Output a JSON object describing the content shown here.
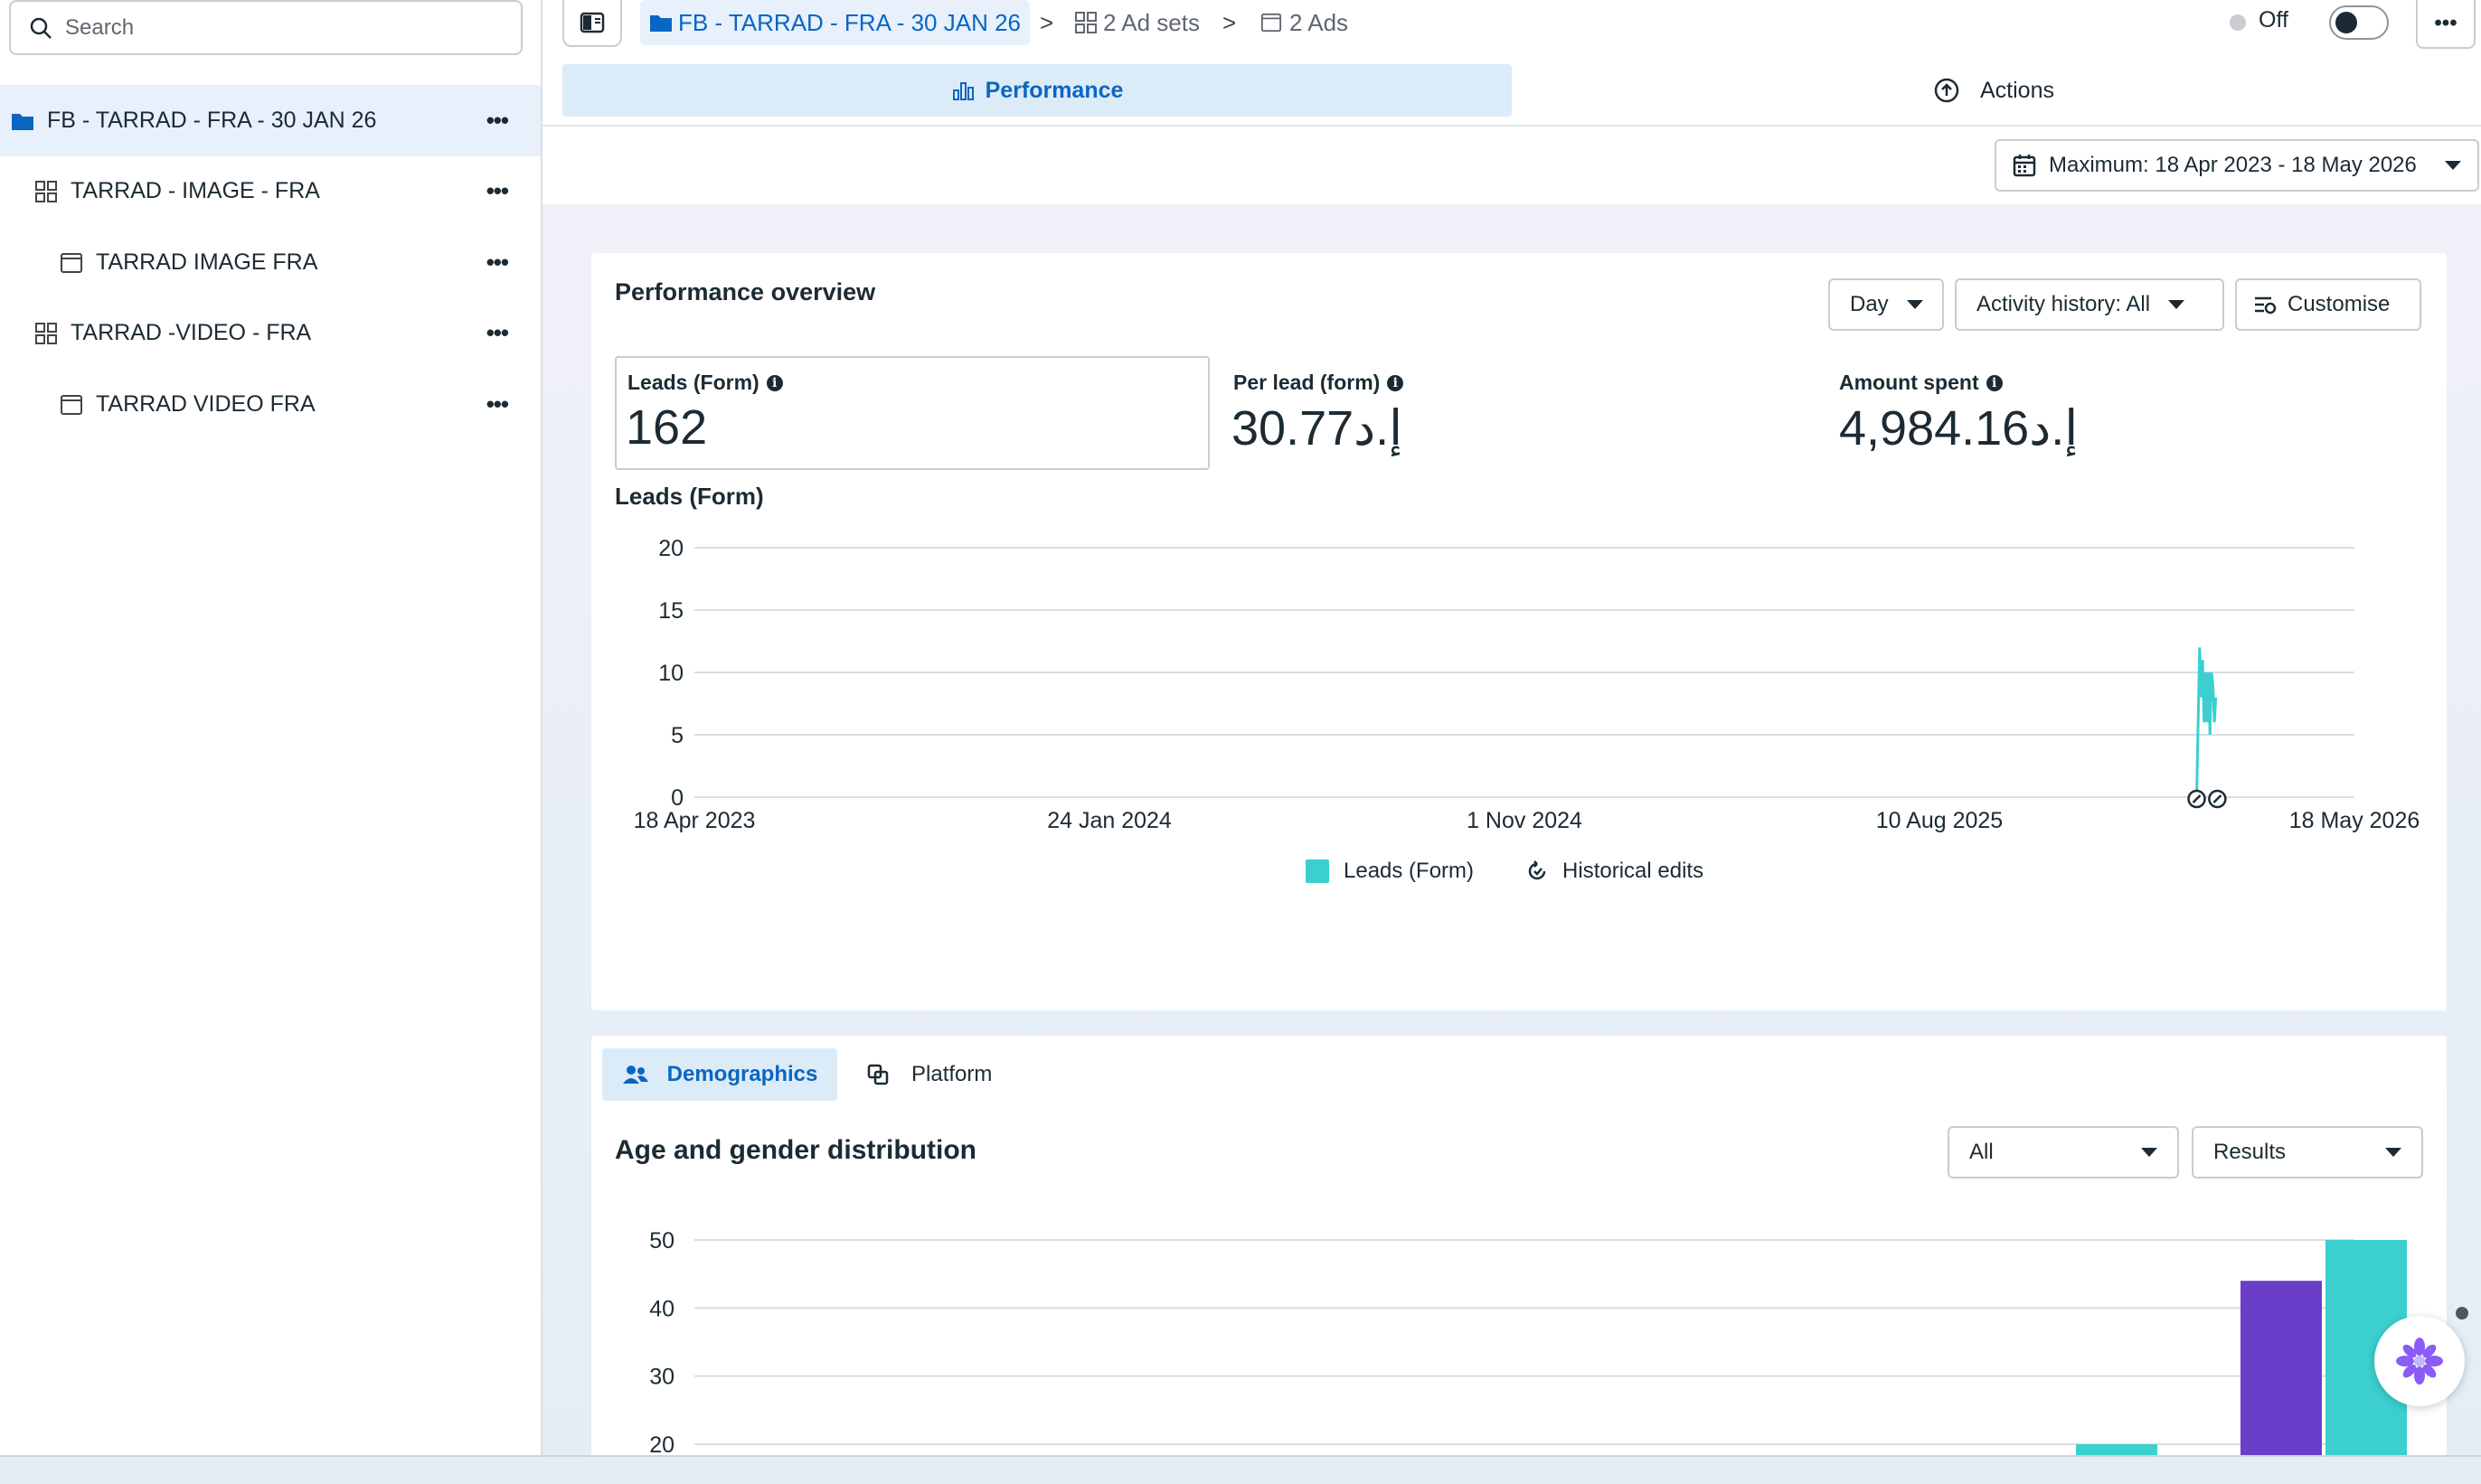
{
  "sidebar": {
    "search_placeholder": "Search",
    "items": [
      {
        "label": "FB - TARRAD - FRA - 30 JAN 26",
        "icon": "folder-icon",
        "more": "•••"
      },
      {
        "label": "TARRAD - IMAGE - FRA",
        "icon": "ad-set-icon",
        "more": "•••"
      },
      {
        "label": "TARRAD IMAGE FRA",
        "icon": "ad-icon",
        "more": "•••"
      },
      {
        "label": "TARRAD -VIDEO - FRA",
        "icon": "ad-set-icon",
        "more": "•••"
      },
      {
        "label": "TARRAD VIDEO FRA",
        "icon": "ad-icon",
        "more": "•••"
      }
    ]
  },
  "breadcrumb": {
    "campaign": "FB - TARRAD - FRA - 30 JAN 26",
    "sep": ">",
    "ad_sets": "2 Ad sets",
    "ads": "2 Ads"
  },
  "status": {
    "label": "Off",
    "more": "•••"
  },
  "tabs": {
    "performance": "Performance",
    "actions": "Actions"
  },
  "date_range": "Maximum: 18 Apr 2023 - 18 May 2026",
  "overview": {
    "title": "Performance overview",
    "granularity": "Day",
    "activity_history": "Activity history: All",
    "customise": "Customise",
    "metrics": [
      {
        "label": "Leads (Form)",
        "value": "162"
      },
      {
        "label": "Per lead (form)",
        "value": "30.77د.إ"
      },
      {
        "label": "Amount spent",
        "value": "4,984.16د.إ"
      }
    ],
    "info": "i"
  },
  "chart_data": [
    {
      "type": "line",
      "title": "Leads (Form)",
      "ylim": [
        0,
        20
      ],
      "yticks": [
        0,
        5,
        10,
        15,
        20
      ],
      "xticks": [
        "18 Apr 2023",
        "24 Jan 2024",
        "1 Nov 2024",
        "10 Aug 2025",
        "18 May 2026"
      ],
      "grid": true,
      "legend": [
        "Leads (Form)",
        "Historical edits"
      ],
      "series": [
        {
          "name": "Leads (Form)",
          "color": "#3ccfcf",
          "points": [
            {
              "x": "2026-01-31",
              "y": 0
            },
            {
              "x": "2026-02-02",
              "y": 12
            },
            {
              "x": "2026-02-03",
              "y": 8
            },
            {
              "x": "2026-02-04",
              "y": 11
            },
            {
              "x": "2026-02-05",
              "y": 6
            },
            {
              "x": "2026-02-06",
              "y": 10
            },
            {
              "x": "2026-02-07",
              "y": 6
            },
            {
              "x": "2026-02-08",
              "y": 10
            },
            {
              "x": "2026-02-09",
              "y": 5
            },
            {
              "x": "2026-02-10",
              "y": 10
            },
            {
              "x": "2026-02-11",
              "y": 9
            },
            {
              "x": "2026-02-12",
              "y": 6
            },
            {
              "x": "2026-02-13",
              "y": 8
            }
          ]
        }
      ],
      "edit_markers": [
        "2026-01-31",
        "2026-02-14"
      ]
    },
    {
      "type": "bar",
      "title": "Age and gender distribution",
      "ylim": [
        20,
        50
      ],
      "yticks": [
        20,
        30,
        40,
        50
      ],
      "grid": true,
      "bars": [
        {
          "value": 20,
          "color": "#3ccfcf"
        },
        {
          "value": 44,
          "color": "#6a3ec8"
        },
        {
          "value": 50,
          "color": "#3ccfcf"
        }
      ]
    }
  ],
  "demographics": {
    "tab": "Demographics",
    "platform_tab": "Platform",
    "title": "Age and gender distribution",
    "filter": "All",
    "metric": "Results"
  }
}
